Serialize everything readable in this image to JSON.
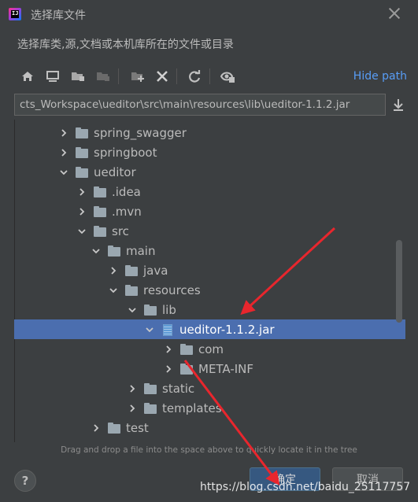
{
  "window": {
    "title": "选择库文件",
    "description": "选择库类,源,文档或本机库所在的文件或目录",
    "app_icon_letter": "IJ"
  },
  "toolbar": {
    "buttons": [
      "home-icon",
      "desktop-icon",
      "new-folder-icon",
      "project-icon",
      "add-folder-icon",
      "delete-icon",
      "refresh-icon",
      "show-hidden-icon"
    ],
    "hide_path_label": "Hide path"
  },
  "path": {
    "value": "cts_Workspace\\ueditor\\src\\main\\resources\\lib\\ueditor-1.1.2.jar"
  },
  "tree": {
    "rows": [
      {
        "label": "spring_swagger",
        "expanded": false,
        "type": "folder"
      },
      {
        "label": "springboot",
        "expanded": false,
        "type": "folder"
      },
      {
        "label": "ueditor",
        "expanded": true,
        "type": "folder"
      },
      {
        "label": ".idea",
        "expanded": false,
        "type": "folder"
      },
      {
        "label": ".mvn",
        "expanded": false,
        "type": "folder"
      },
      {
        "label": "src",
        "expanded": true,
        "type": "folder"
      },
      {
        "label": "main",
        "expanded": true,
        "type": "folder"
      },
      {
        "label": "java",
        "expanded": false,
        "type": "folder"
      },
      {
        "label": "resources",
        "expanded": true,
        "type": "folder"
      },
      {
        "label": "lib",
        "expanded": true,
        "type": "folder"
      },
      {
        "label": "ueditor-1.1.2.jar",
        "expanded": true,
        "type": "jar",
        "selected": true
      },
      {
        "label": "com",
        "expanded": false,
        "type": "folder"
      },
      {
        "label": "META-INF",
        "expanded": false,
        "type": "folder"
      },
      {
        "label": "static",
        "expanded": false,
        "type": "folder"
      },
      {
        "label": "templates",
        "expanded": false,
        "type": "folder"
      },
      {
        "label": "test",
        "expanded": false,
        "type": "folder"
      }
    ]
  },
  "hint": "Drag and drop a file into the space above to quickly locate it in the tree",
  "buttons": {
    "help": "?",
    "ok": "确定",
    "cancel": "取消"
  },
  "watermark": "https://blog.csdn.net/baidu_25117757",
  "colors": {
    "background": "#3c3f41",
    "selection": "#4b6eaf",
    "link": "#589df6",
    "annotation_arrow": "#e8262d"
  }
}
